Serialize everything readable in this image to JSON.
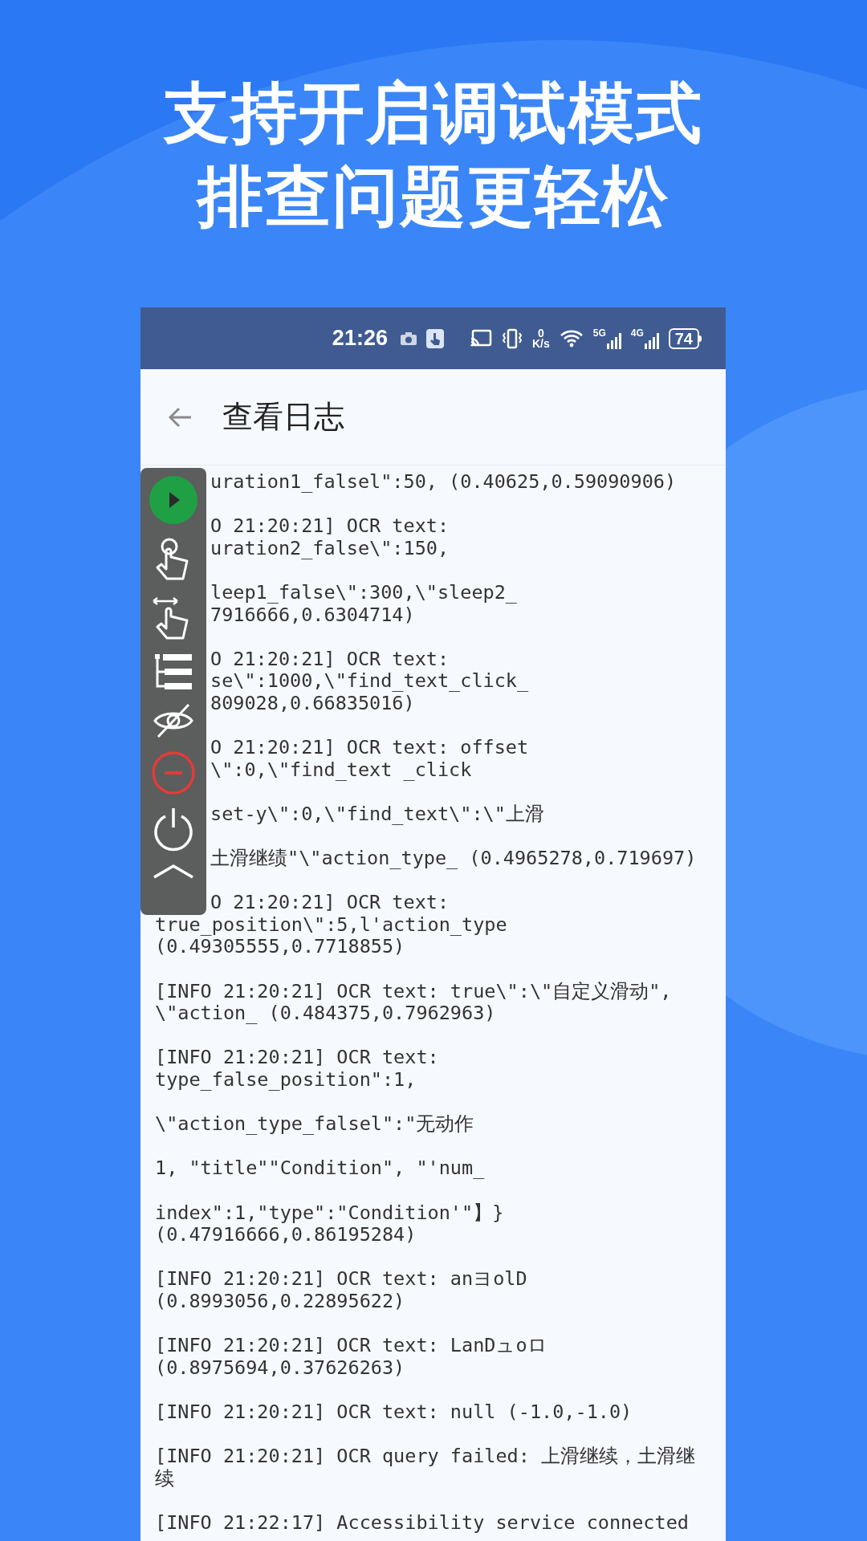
{
  "headline": [
    "支持开启调试模式",
    "排查问题更轻松"
  ],
  "status_bar": {
    "time": "21:26",
    "net_speed_value": "0",
    "net_speed_unit": "K/s",
    "sim1": "5G",
    "sim2": "4G",
    "battery": "74"
  },
  "header": {
    "title": "查看日志"
  },
  "log_beside_toolbar": [
    [
      "uration1_falsel\":50, (0.40625,0.59090906)"
    ],
    [
      "O 21:20:21] OCR text:",
      "uration2_false\\\":150,"
    ],
    [
      "leep1_false\\\":300,\\\"sleep2_",
      "7916666,0.6304714)"
    ],
    [
      "O 21:20:21] OCR text:",
      "se\\\":1000,\\\"find_text_click_",
      "809028,0.66835016)"
    ],
    [
      "O 21:20:21] OCR text: offset",
      "\\\":0,\\\"find_text _click"
    ],
    [
      "set-y\\\":0,\\\"find_text\\\":\\\"上滑"
    ],
    [
      "土滑继绩\"\\\"action_type_ (0.4965278,0.719697)"
    ],
    [
      "O 21:20:21] OCR text:"
    ]
  ],
  "log": [
    [
      "true_position\\\":5,l'action_type",
      "(0.49305555,0.7718855)"
    ],
    [
      "[INFO 21:20:21] OCR text: true\\\":\\\"自定义滑动\",",
      "\\\"action_ (0.484375,0.7962963)"
    ],
    [
      "[INFO 21:20:21] OCR text:",
      "type_false_position\":1,"
    ],
    [
      "\\\"action_type_falsel\":\"无动作"
    ],
    [
      "1, \"title\"\"Condition\", \"'num_"
    ],
    [
      "index\":1,\"type\":\"Condition'\"】}",
      "(0.47916666,0.86195284)"
    ],
    [
      "[INFO 21:20:21] OCR text: anヨolD",
      "(0.8993056,0.22895622)"
    ],
    [
      "[INFO 21:20:21] OCR text: LanDュoロ",
      "(0.8975694,0.37626263)"
    ],
    [
      "[INFO 21:20:21] OCR text: null (-1.0,-1.0)"
    ],
    [
      "[INFO 21:20:21] OCR query failed: 上滑继续，土滑继",
      "续"
    ],
    [
      "[INFO 21:22:17] Accessibility service connected"
    ]
  ]
}
